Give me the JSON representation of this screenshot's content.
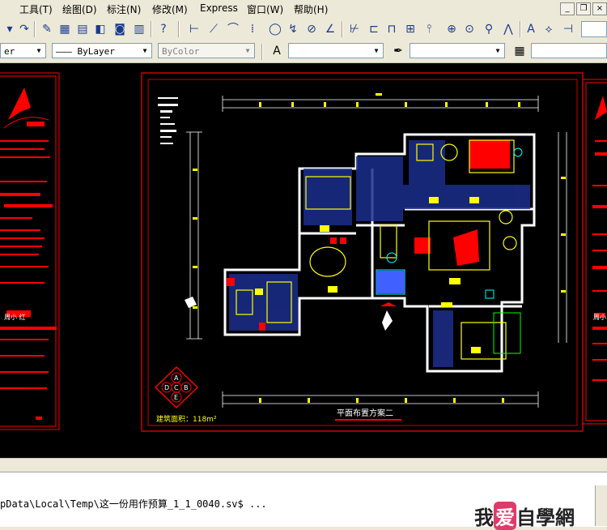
{
  "menu": {
    "tools": "工具(T)",
    "draw": "绘图(D)",
    "dimension": "标注(N)",
    "modify": "修改(M)",
    "express": "Express",
    "window": "窗口(W)",
    "help": "帮助(H)"
  },
  "properties": {
    "layer_value": "er",
    "linetype_value": "——— ByLayer",
    "color_value": "ByColor"
  },
  "drawing": {
    "plan_title": "平面布置方案二",
    "area_label": "建筑面积：118m²",
    "compass_letters": [
      "A",
      "B",
      "C",
      "D",
      "E"
    ],
    "left_panel_name": "周小 红",
    "right_panel_name": "周小"
  },
  "command": {
    "line": "pData\\Local\\Temp\\这一份用作预算_1_1_0040.sv$ ..."
  },
  "watermark": {
    "part1": "我",
    "heart": "爱",
    "part2": "自學網"
  },
  "colors": {
    "canvas": "#000000",
    "red": "#ff0000",
    "yellow": "#ffff00",
    "white": "#ffffff",
    "cyan": "#00ffff",
    "blue": "#4060ff"
  }
}
